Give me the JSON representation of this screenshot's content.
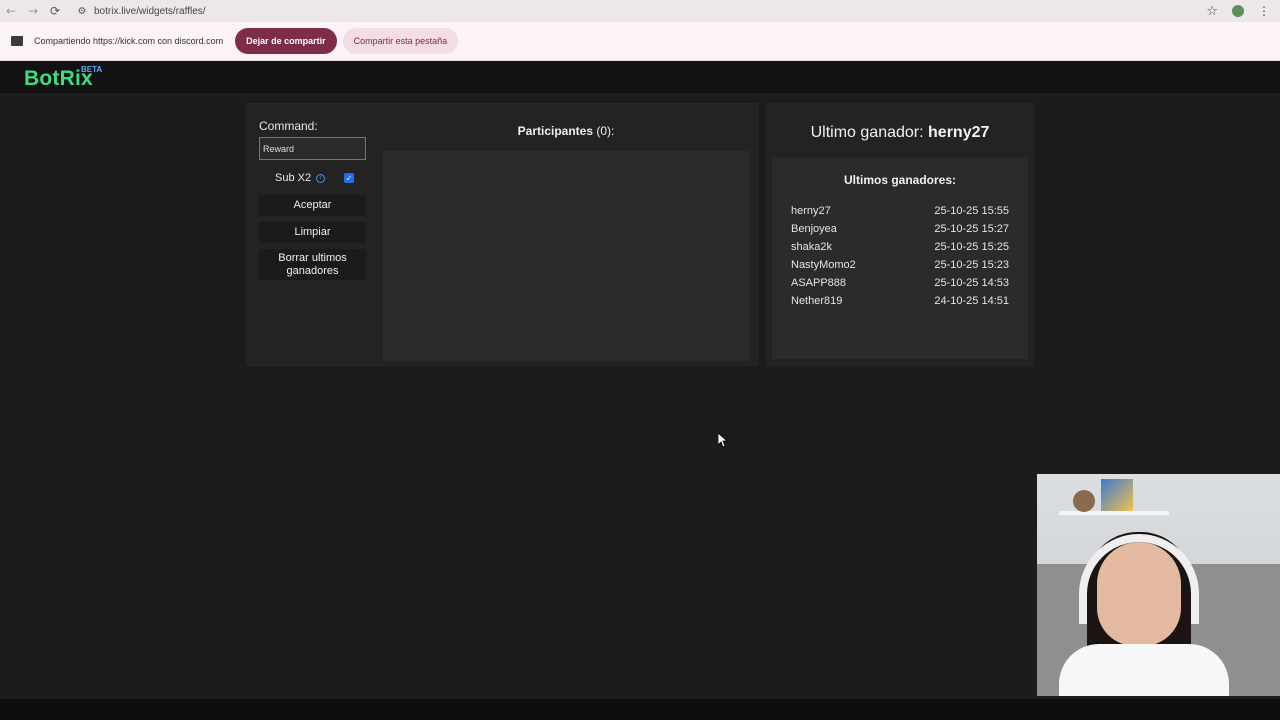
{
  "browser": {
    "back_icon": "←",
    "forward_icon": "→",
    "reload_icon": "⟳",
    "site_icon": "⚙",
    "url": "botrix.live/widgets/raffles/",
    "star_icon": "☆",
    "menu_icon": "⋮"
  },
  "share_bar": {
    "text": "Compartiendo https://kick.com con discord.com",
    "stop_label": "Dejar de compartir",
    "share_tab_label": "Compartir esta pestaña"
  },
  "header": {
    "logo": "BotRix",
    "beta": "BETA"
  },
  "raffle": {
    "command_label": "Command:",
    "command_value": "Reward",
    "sub_label": "Sub X2",
    "info_icon": "i",
    "sub_checked": true,
    "check_mark": "✓",
    "accept_label": "Aceptar",
    "clear_label": "Limpiar",
    "delete_label": "Borrar ultimos ganadores",
    "participants_label": "Participantes",
    "participants_count": "(0):"
  },
  "winners": {
    "last_winner_label": "Ultimo ganador:",
    "last_winner_name": "herny27",
    "title": "Ultimos ganadores:",
    "list": [
      {
        "name": "herny27",
        "date": "25-10-25 15:55"
      },
      {
        "name": "Benjoyea",
        "date": "25-10-25 15:27"
      },
      {
        "name": "shaka2k",
        "date": "25-10-25 15:25"
      },
      {
        "name": "NastyMomo2",
        "date": "25-10-25 15:23"
      },
      {
        "name": "ASAPP888",
        "date": "25-10-25 14:53"
      },
      {
        "name": "Nether819",
        "date": "24-10-25 14:51"
      }
    ]
  },
  "colors": {
    "logo": "#3ddc84",
    "beta": "#5aa8ff",
    "stop_button": "#7d2d4a",
    "checkbox": "#1a73e8"
  }
}
